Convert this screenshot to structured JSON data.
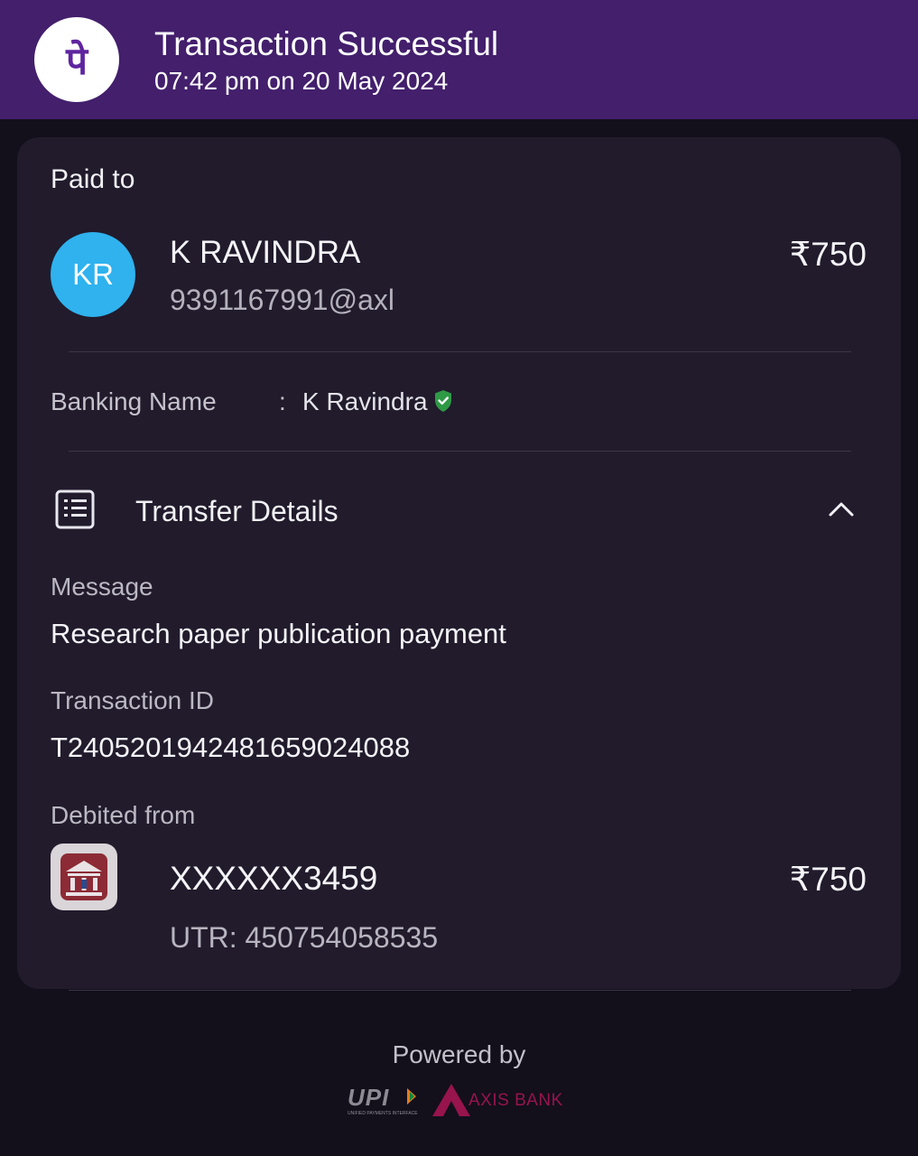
{
  "header": {
    "title": "Transaction Successful",
    "datetime": "07:42 pm on 20 May 2024",
    "logo_glyph": "पे",
    "colors": {
      "background": "#431f6c",
      "logo": "#5f259f"
    }
  },
  "payee": {
    "section_label": "Paid to",
    "initials": "KR",
    "name": "K RAVINDRA",
    "upi_id": "9391167991@axl",
    "amount": "₹750",
    "avatar_color": "#2fb2ee"
  },
  "banking": {
    "label": "Banking Name",
    "separator": ":",
    "value": "K Ravindra",
    "verified_color": "#2e9a45"
  },
  "transfer_details": {
    "title": "Transfer Details",
    "message_label": "Message",
    "message": "Research paper publication payment",
    "txn_id_label": "Transaction ID",
    "txn_id": "T2405201942481659024088",
    "debited_label": "Debited from",
    "account": "XXXXXX3459",
    "amount": "₹750",
    "utr": "UTR: 450754058535"
  },
  "footer": {
    "powered_by": "Powered by",
    "upi_logo_text": "UPI",
    "upi_tagline": "UNIFIED PAYMENTS INTERFACE",
    "bank_name": "AXIS BANK",
    "bank_color": "#97144d"
  }
}
